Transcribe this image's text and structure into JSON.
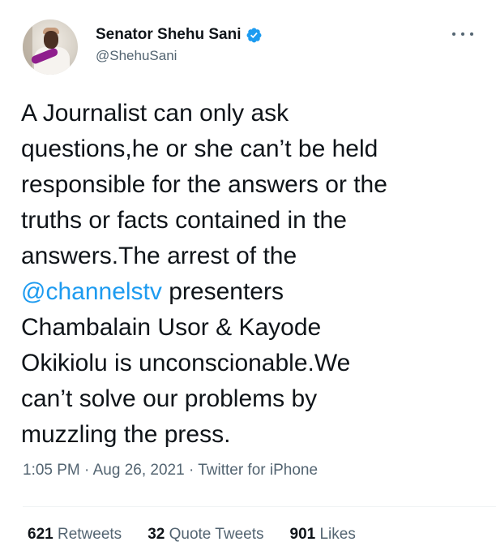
{
  "user": {
    "display_name": "Senator Shehu Sani",
    "handle": "@ShehuSani"
  },
  "tweet": {
    "lines": [
      {
        "text": "A Journalist can only ask"
      },
      {
        "text": "questions,he or she can’t be held"
      },
      {
        "text": "responsible for the answers or the"
      },
      {
        "text": "truths or facts contained in the"
      },
      {
        "text": "answers.The arrest of the"
      },
      {
        "mention": "@channelstv",
        "text": " presenters"
      },
      {
        "text": "Chambalain Usor & Kayode"
      },
      {
        "text": "Okikiolu is unconscionable.We"
      },
      {
        "text": "can’t solve our problems by"
      },
      {
        "text": "muzzling the press."
      }
    ]
  },
  "meta": {
    "time": "1:05 PM",
    "date": "Aug 26, 2021",
    "source": "Twitter for iPhone",
    "separator": "·"
  },
  "stats": {
    "retweets_count": "621",
    "retweets_label": "Retweets",
    "quotes_count": "32",
    "quotes_label": "Quote Tweets",
    "likes_count": "901",
    "likes_label": "Likes"
  },
  "icons": {
    "verified": "verified-badge-icon",
    "more": "more-options-icon"
  },
  "colors": {
    "link": "#1d9bf0",
    "secondary_text": "#536471",
    "primary_text": "#0f1419"
  }
}
